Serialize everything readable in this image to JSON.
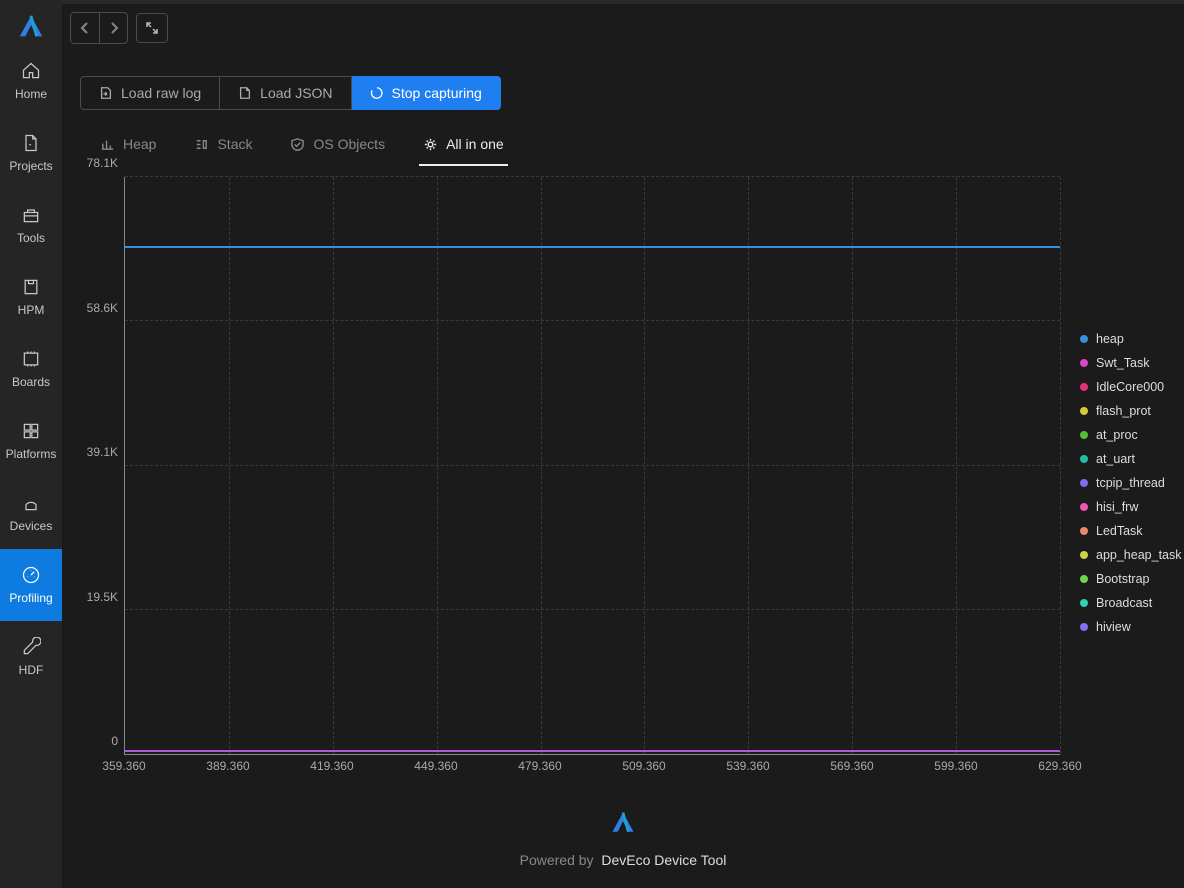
{
  "sidebar": {
    "items": [
      {
        "label": "Home"
      },
      {
        "label": "Projects"
      },
      {
        "label": "Tools"
      },
      {
        "label": "HPM"
      },
      {
        "label": "Boards"
      },
      {
        "label": "Platforms"
      },
      {
        "label": "Devices"
      },
      {
        "label": "Profiling"
      },
      {
        "label": "HDF"
      }
    ],
    "active_index": 7
  },
  "toolbar": {
    "load_raw_label": "Load raw log",
    "load_json_label": "Load JSON",
    "stop_label": "Stop capturing"
  },
  "tabs": {
    "items": [
      {
        "label": "Heap"
      },
      {
        "label": "Stack"
      },
      {
        "label": "OS Objects"
      },
      {
        "label": "All in one"
      }
    ],
    "active_index": 3
  },
  "footer": {
    "prefix": "Powered by",
    "brand": "DevEco Device Tool"
  },
  "legend": {
    "items": [
      {
        "name": "heap",
        "color": "#3a8fdd"
      },
      {
        "name": "Swt_Task",
        "color": "#d846c5"
      },
      {
        "name": "IdleCore000",
        "color": "#e2347a"
      },
      {
        "name": "flash_prot",
        "color": "#d6c93a"
      },
      {
        "name": "at_proc",
        "color": "#4fbf3a"
      },
      {
        "name": "at_uart",
        "color": "#1fbfa7"
      },
      {
        "name": "tcpip_thread",
        "color": "#7a6ff0"
      },
      {
        "name": "hisi_frw",
        "color": "#e85ab5"
      },
      {
        "name": "LedTask",
        "color": "#e58b6a"
      },
      {
        "name": "app_heap_task",
        "color": "#cdd246"
      },
      {
        "name": "Bootstrap",
        "color": "#6ed34e"
      },
      {
        "name": "Broadcast",
        "color": "#2dd3b4"
      },
      {
        "name": "hiview",
        "color": "#8a6df2"
      }
    ]
  },
  "chart_data": {
    "type": "line",
    "title": "",
    "xlabel": "",
    "ylabel": "",
    "ylim": [
      0,
      78100
    ],
    "y_ticks": [
      "0",
      "19.5K",
      "39.1K",
      "58.6K",
      "78.1K"
    ],
    "x_ticks": [
      "359.360",
      "389.360",
      "419.360",
      "449.360",
      "479.360",
      "509.360",
      "539.360",
      "569.360",
      "599.360",
      "629.360"
    ],
    "x": [
      359.36,
      629.36
    ],
    "series": [
      {
        "name": "heap",
        "values": [
          68500,
          68500
        ]
      },
      {
        "name": "Swt_Task",
        "values": [
          500,
          500
        ]
      },
      {
        "name": "IdleCore000",
        "values": [
          400,
          400
        ]
      },
      {
        "name": "flash_prot",
        "values": [
          400,
          400
        ]
      },
      {
        "name": "at_proc",
        "values": [
          400,
          400
        ]
      },
      {
        "name": "at_uart",
        "values": [
          400,
          400
        ]
      },
      {
        "name": "tcpip_thread",
        "values": [
          400,
          400
        ]
      },
      {
        "name": "hisi_frw",
        "values": [
          400,
          400
        ]
      },
      {
        "name": "LedTask",
        "values": [
          300,
          300
        ]
      },
      {
        "name": "app_heap_task",
        "values": [
          300,
          300
        ]
      },
      {
        "name": "Bootstrap",
        "values": [
          300,
          300
        ]
      },
      {
        "name": "Broadcast",
        "values": [
          300,
          300
        ]
      },
      {
        "name": "hiview",
        "values": [
          300,
          300
        ]
      }
    ]
  }
}
